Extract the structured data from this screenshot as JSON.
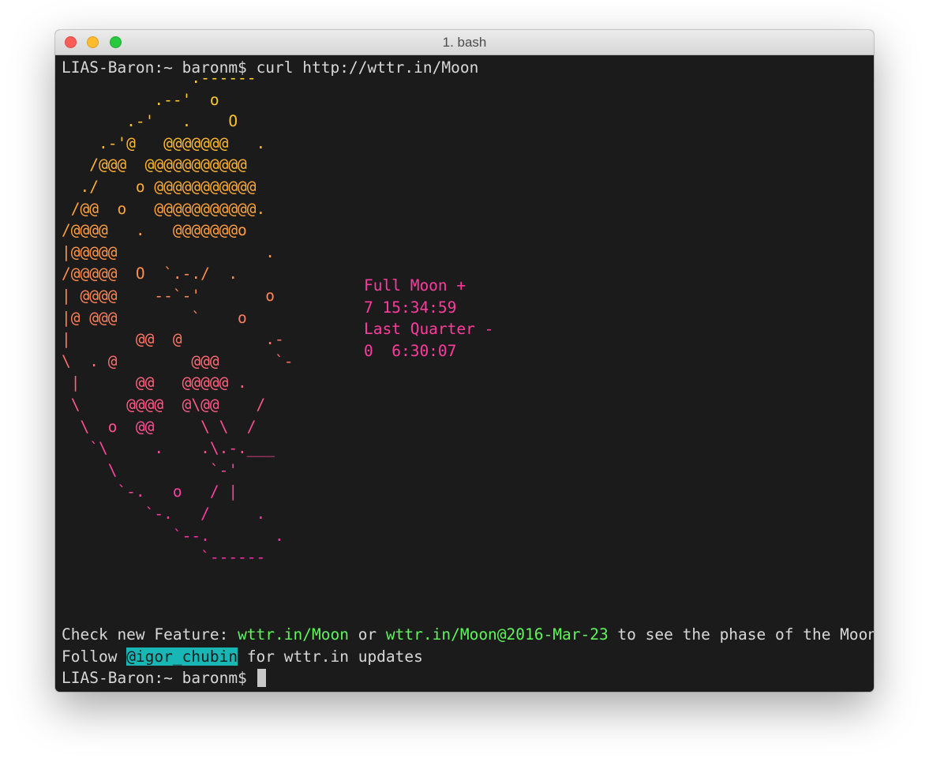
{
  "window": {
    "title": "1. bash"
  },
  "terminal": {
    "prompt": "LIAS-Baron:~ baronm$",
    "command": "curl http://wttr.in/Moon",
    "moon_art": [
      "              .------",
      "          .--'  o",
      "       .-'   .    O",
      "    .-'@   @@@@@@@   .",
      "   /@@@  @@@@@@@@@@@",
      "  ./    o @@@@@@@@@@@",
      " /@@  o   @@@@@@@@@@@.",
      "/@@@@   .   @@@@@@@o",
      "|@@@@@                .",
      "/@@@@@  O  `.-./  .",
      "| @@@@    --`-'       o",
      "|@ @@@        `    o",
      "|       @@  @         .-",
      "\\  . @        @@@      `-",
      " |      @@   @@@@@ .",
      " \\     @@@@  @\\@@    /",
      "  \\  o  @@     \\ \\  /",
      "   `\\     .    .\\.-.___",
      "     \\          `-'",
      "      `-.   o   / |",
      "         `-.   /     .",
      "            `--.       .",
      "               `------"
    ],
    "phase_info": [
      "Full Moon +",
      "7 15:34:59",
      "Last Quarter -",
      "0  6:30:07"
    ],
    "feature_line": {
      "prefix": "Check new Feature: ",
      "link1": "wttr.in/Moon",
      "mid": " or ",
      "link2": "wttr.in/Moon@2016-Mar-23",
      "suffix": " to see the phase of the Moon"
    },
    "follow_line": {
      "prefix": "Follow ",
      "handle": "@igor_chubin",
      "suffix": " for wttr.in updates"
    },
    "final_prompt": "LIAS-Baron:~ baronm$ "
  },
  "colors": {
    "background": "#1b1b1b",
    "foreground": "#d8d8d8",
    "link_green": "#5ff55a",
    "phase_pink": "#ff3c9e",
    "handle_bg": "#18b7b5",
    "moon_gradient": [
      "#ffd21f",
      "#ffa838",
      "#ff7f5e",
      "#ff4c96",
      "#ff2fae"
    ]
  }
}
